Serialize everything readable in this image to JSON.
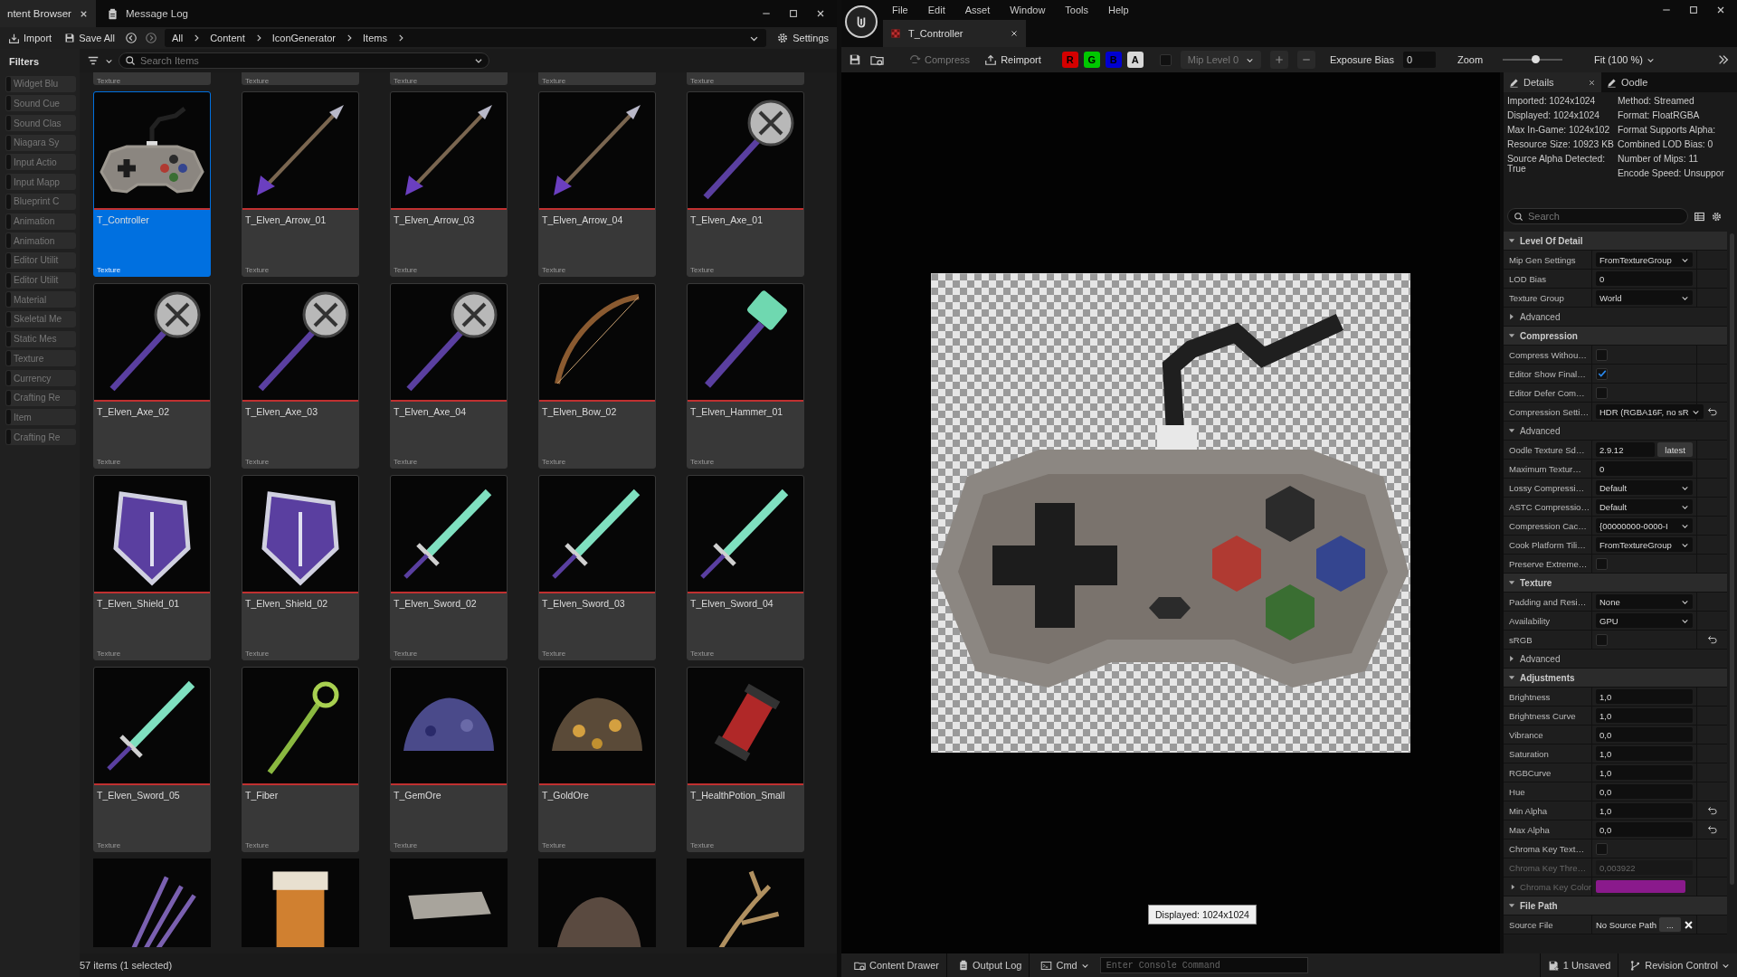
{
  "content_browser": {
    "tabs": [
      {
        "label": "ntent Browser",
        "selected": true
      },
      {
        "label": "Message Log",
        "selected": false
      }
    ],
    "toolbar": {
      "import": "Import",
      "save_all": "Save All",
      "breadcrumbs": [
        "All",
        "Content",
        "IconGenerator",
        "Items"
      ],
      "settings": "Settings"
    },
    "filters": {
      "title": "Filters",
      "items": [
        {
          "label": "Widget Blu",
          "checked": false
        },
        {
          "label": "Sound Cue",
          "checked": false
        },
        {
          "label": "Sound Clas",
          "checked": false
        },
        {
          "label": "Niagara Sy",
          "checked": false
        },
        {
          "label": "Input Actio",
          "checked": false
        },
        {
          "label": "Input Mapp",
          "checked": false
        },
        {
          "label": "Blueprint C",
          "checked": false
        },
        {
          "label": "Animation",
          "checked": false
        },
        {
          "label": "Animation",
          "checked": false
        },
        {
          "label": "Editor Utilit",
          "checked": false
        },
        {
          "label": "Editor Utilit",
          "checked": false
        },
        {
          "label": "Material",
          "checked": false
        },
        {
          "label": "Skeletal Me",
          "checked": false
        },
        {
          "label": "Static Mes",
          "checked": false
        },
        {
          "label": "Texture",
          "checked": false
        },
        {
          "label": "Currency",
          "checked": false
        },
        {
          "label": "Crafting Re",
          "checked": false
        },
        {
          "label": "Item",
          "checked": false
        },
        {
          "label": "Crafting Re",
          "checked": false
        }
      ]
    },
    "search": {
      "placeholder": "Search Items"
    },
    "top_row": [
      "Texture",
      "Texture",
      "Texture",
      "Texture",
      "Texture"
    ],
    "assets": [
      {
        "name": "T_Controller",
        "type": "Texture",
        "kind": "controller",
        "selected": true
      },
      {
        "name": "T_Elven_Arrow_01",
        "type": "Texture",
        "kind": "arrow",
        "selected": false
      },
      {
        "name": "T_Elven_Arrow_03",
        "type": "Texture",
        "kind": "arrow",
        "selected": false
      },
      {
        "name": "T_Elven_Arrow_04",
        "type": "Texture",
        "kind": "arrow",
        "selected": false
      },
      {
        "name": "T_Elven_Axe_01",
        "type": "Texture",
        "kind": "axe",
        "selected": false
      },
      {
        "name": "T_Elven_Axe_02",
        "type": "Texture",
        "kind": "axe",
        "selected": false
      },
      {
        "name": "T_Elven_Axe_03",
        "type": "Texture",
        "kind": "axe",
        "selected": false
      },
      {
        "name": "T_Elven_Axe_04",
        "type": "Texture",
        "kind": "axe",
        "selected": false
      },
      {
        "name": "T_Elven_Bow_02",
        "type": "Texture",
        "kind": "bow",
        "selected": false
      },
      {
        "name": "T_Elven_Hammer_01",
        "type": "Texture",
        "kind": "hammer",
        "selected": false
      },
      {
        "name": "T_Elven_Shield_01",
        "type": "Texture",
        "kind": "shield",
        "selected": false
      },
      {
        "name": "T_Elven_Shield_02",
        "type": "Texture",
        "kind": "shield",
        "selected": false
      },
      {
        "name": "T_Elven_Sword_02",
        "type": "Texture",
        "kind": "sword",
        "selected": false
      },
      {
        "name": "T_Elven_Sword_03",
        "type": "Texture",
        "kind": "sword",
        "selected": false
      },
      {
        "name": "T_Elven_Sword_04",
        "type": "Texture",
        "kind": "sword",
        "selected": false
      },
      {
        "name": "T_Elven_Sword_05",
        "type": "Texture",
        "kind": "sword",
        "selected": false
      },
      {
        "name": "T_Fiber",
        "type": "Texture",
        "kind": "fiber",
        "selected": false
      },
      {
        "name": "T_GemOre",
        "type": "Texture",
        "kind": "gems",
        "selected": false
      },
      {
        "name": "T_GoldOre",
        "type": "Texture",
        "kind": "gold",
        "selected": false
      },
      {
        "name": "T_HealthPotion_Small",
        "type": "Texture",
        "kind": "potion",
        "selected": false
      }
    ],
    "bottom_row": [
      {
        "kind": "lavender"
      },
      {
        "kind": "crate"
      },
      {
        "kind": "slab"
      },
      {
        "kind": "rock"
      },
      {
        "kind": "branch"
      }
    ],
    "status": "57 items (1 selected)"
  },
  "texture_editor": {
    "menu": [
      "File",
      "Edit",
      "Asset",
      "Window",
      "Tools",
      "Help"
    ],
    "tab": {
      "label": "T_Controller"
    },
    "toolbar": {
      "compress": {
        "label": "Compress",
        "disabled": true
      },
      "reimport": "Reimport",
      "channels": [
        {
          "label": "R",
          "color": "#d40000",
          "on": true
        },
        {
          "label": "G",
          "color": "#00c800",
          "on": true
        },
        {
          "label": "B",
          "color": "#0000d0",
          "on": true
        },
        {
          "label": "A",
          "color": "#d8d8d8",
          "on": true
        }
      ],
      "mip_checkbox": {
        "checked": false
      },
      "mip": {
        "label": "Mip Level 0",
        "disabled": true
      },
      "exposure_label": "Exposure Bias",
      "exposure_value": "0",
      "zoom_label": "Zoom",
      "zoom": {
        "level": 0.55
      },
      "fit": "Fit (100 %)"
    },
    "viewport": {
      "tooltip": "Displayed: 1024x1024"
    },
    "details": {
      "tabs": [
        {
          "label": "Details",
          "selected": true
        },
        {
          "label": "Oodle",
          "selected": false
        }
      ],
      "info_left": [
        "Imported: 1024x1024",
        "Displayed: 1024x1024",
        "Max In-Game: 1024x102",
        "Resource Size: 10923 KB",
        "Source Alpha Detected: True"
      ],
      "info_right": [
        "Method: Streamed",
        "Format: FloatRGBA",
        "Format Supports Alpha:",
        "Combined LOD Bias: 0",
        "Number of Mips: 11",
        "Encode Speed: Unsuppor"
      ],
      "search": {
        "placeholder": "Search"
      },
      "categories": [
        {
          "label": "Level Of Detail",
          "expanded": true,
          "children": [
            {
              "kind": "dropdown",
              "label": "Mip Gen Settings",
              "value": "FromTextureGroup",
              "disabled": false,
              "reset": false
            },
            {
              "kind": "input",
              "label": "LOD Bias",
              "value": "0",
              "disabled": false,
              "reset": false
            },
            {
              "kind": "dropdown",
              "label": "Texture Group",
              "value": "World",
              "disabled": false,
              "reset": false
            },
            {
              "kind": "group",
              "label": "Advanced",
              "expanded": false
            }
          ]
        },
        {
          "label": "Compression",
          "expanded": true,
          "children": [
            {
              "kind": "checkbox",
              "label": "Compress Withou…",
              "checked": false,
              "disabled": false,
              "reset": false
            },
            {
              "kind": "checkbox",
              "label": "Editor Show Final…",
              "checked": true,
              "disabled": false,
              "reset": false
            },
            {
              "kind": "checkbox",
              "label": "Editor Defer Com…",
              "checked": false,
              "disabled": false,
              "reset": false
            },
            {
              "kind": "dropdown",
              "label": "Compression Setti…",
              "value": "HDR (RGBA16F, no sR",
              "disabled": false,
              "reset": true
            },
            {
              "kind": "group",
              "label": "Advanced",
              "expanded": true,
              "children": [
                {
                  "kind": "version",
                  "label": "Oodle Texture Sd…",
                  "value": "2.9.12",
                  "button": "latest",
                  "disabled": false,
                  "reset": false
                },
                {
                  "kind": "input",
                  "label": "Maximum Textur…",
                  "value": "0",
                  "disabled": false,
                  "reset": false
                },
                {
                  "kind": "dropdown",
                  "label": "Lossy Compressi…",
                  "value": "Default",
                  "disabled": false,
                  "reset": false
                },
                {
                  "kind": "dropdown",
                  "label": "ASTC Compressio…",
                  "value": "Default",
                  "disabled": false,
                  "reset": false
                },
                {
                  "kind": "dropdown",
                  "label": "Compression Cac…",
                  "value": "{00000000-0000-I",
                  "disabled": false,
                  "reset": false
                },
                {
                  "kind": "dropdown",
                  "label": "Cook Platform Tili…",
                  "value": "FromTextureGroup",
                  "disabled": false,
                  "reset": false
                },
                {
                  "kind": "checkbox",
                  "label": "Preserve Extreme…",
                  "checked": false,
                  "disabled": false,
                  "reset": false
                }
              ]
            }
          ]
        },
        {
          "label": "Texture",
          "expanded": true,
          "children": [
            {
              "kind": "dropdown",
              "label": "Padding and Resi…",
              "value": "None",
              "disabled": false,
              "reset": false
            },
            {
              "kind": "dropdown",
              "label": "Availability",
              "value": "GPU",
              "disabled": false,
              "reset": false
            },
            {
              "kind": "checkbox",
              "label": "sRGB",
              "checked": false,
              "disabled": false,
              "reset": true
            },
            {
              "kind": "group",
              "label": "Advanced",
              "expanded": false
            }
          ]
        },
        {
          "label": "Adjustments",
          "expanded": true,
          "children": [
            {
              "kind": "input",
              "label": "Brightness",
              "value": "1,0",
              "disabled": false,
              "reset": false
            },
            {
              "kind": "input",
              "label": "Brightness Curve",
              "value": "1,0",
              "disabled": false,
              "reset": false
            },
            {
              "kind": "input",
              "label": "Vibrance",
              "value": "0,0",
              "disabled": false,
              "reset": false
            },
            {
              "kind": "input",
              "label": "Saturation",
              "value": "1,0",
              "disabled": false,
              "reset": false
            },
            {
              "kind": "input",
              "label": "RGBCurve",
              "value": "1,0",
              "disabled": false,
              "reset": false
            },
            {
              "kind": "input",
              "label": "Hue",
              "value": "0,0",
              "disabled": false,
              "reset": false
            },
            {
              "kind": "input",
              "label": "Min Alpha",
              "value": "1,0",
              "disabled": false,
              "reset": true
            },
            {
              "kind": "input",
              "label": "Max Alpha",
              "value": "0,0",
              "disabled": false,
              "reset": true
            },
            {
              "kind": "checkbox",
              "label": "Chroma Key Text…",
              "checked": false,
              "disabled": false,
              "reset": false
            },
            {
              "kind": "input",
              "label": "Chroma Key Thre…",
              "value": "0,003922",
              "disabled": true,
              "reset": false
            },
            {
              "kind": "color",
              "label": "Chroma Key Color",
              "color": "#8a1a8c",
              "expanded": false,
              "disabled": true,
              "reset": false
            }
          ]
        },
        {
          "label": "File Path",
          "expanded": true,
          "children": [
            {
              "kind": "path",
              "label": "Source File",
              "value": "No Source Path",
              "button": "...",
              "disabled": false,
              "reset": false
            }
          ]
        }
      ]
    },
    "bottom_bar": {
      "content_drawer": "Content Drawer",
      "output_log": "Output Log",
      "cmd": "Cmd",
      "console": {
        "placeholder": "Enter Console Command"
      },
      "unsaved": "1 Unsaved",
      "revision_control": "Revision Control"
    }
  }
}
